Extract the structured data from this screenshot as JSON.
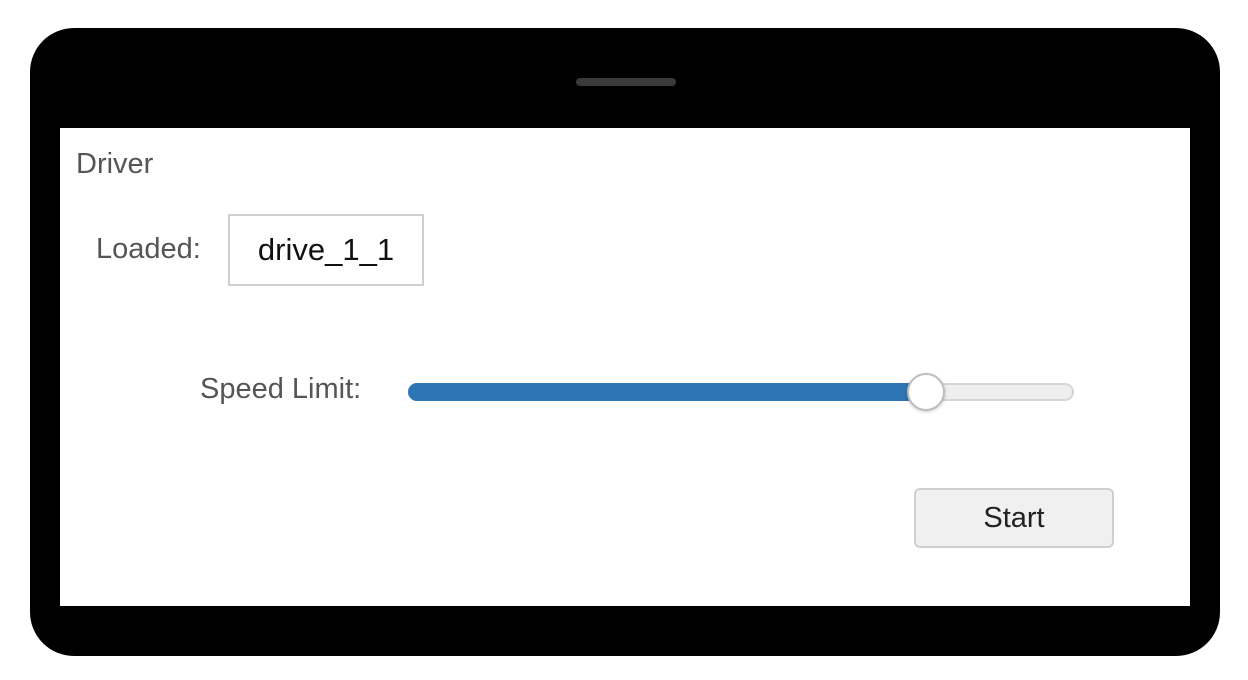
{
  "window": {
    "title": "Driver"
  },
  "loaded": {
    "label": "Loaded:",
    "value": "drive_1_1"
  },
  "speed_limit": {
    "label": "Speed Limit:",
    "fraction": 0.78,
    "fill_color": "#2f74b5"
  },
  "actions": {
    "start_label": "Start"
  }
}
